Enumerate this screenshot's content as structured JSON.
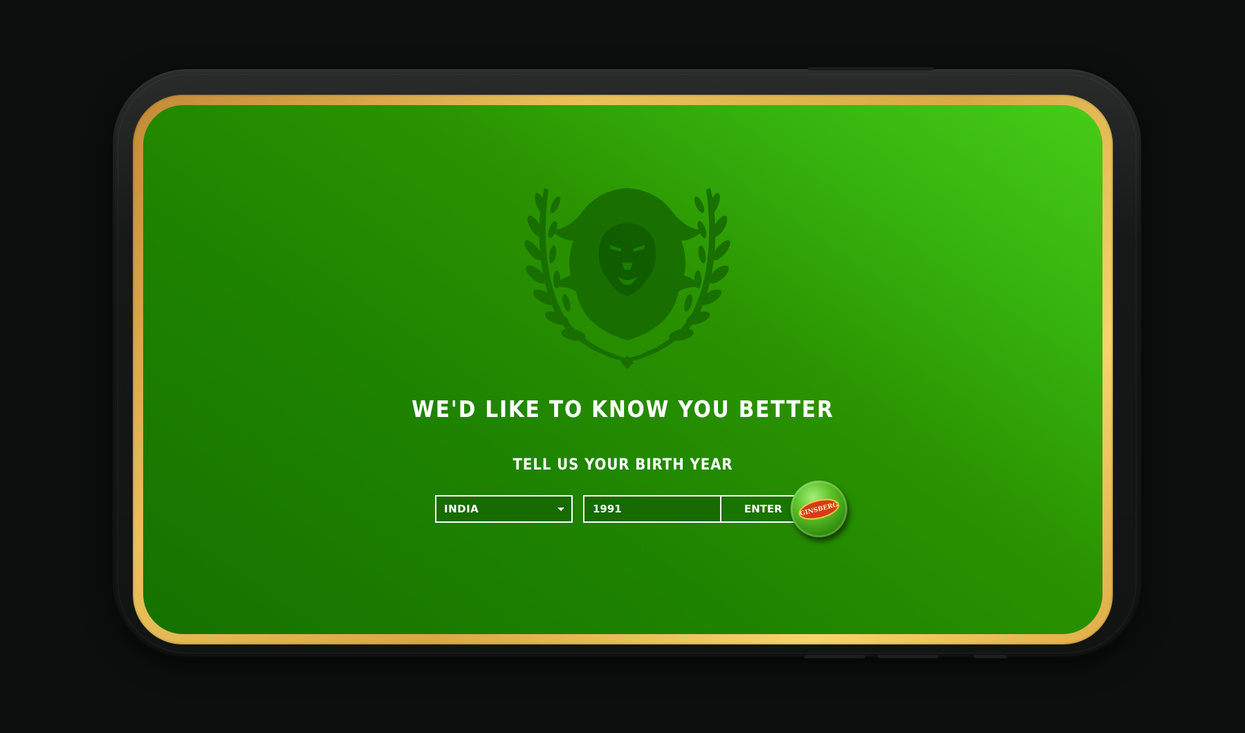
{
  "age_gate": {
    "headline": "WE'D LIKE TO KNOW YOU BETTER",
    "subheadline": "TELL US YOUR BIRTH YEAR",
    "country_select": {
      "selected": "INDIA"
    },
    "birth_year_input": {
      "value": "1991"
    },
    "enter_button": {
      "label": "ENTER"
    },
    "brand_badge": {
      "text": "GINSBERG"
    }
  },
  "colors": {
    "background": "#0d0f0f",
    "screen_green": "#1f8500",
    "field_green": "#176b00",
    "gold_bezel": "#e9c15a",
    "text": "#ffffff"
  },
  "icons": {
    "emblem": "lion-laurel-crest-icon",
    "dropdown": "caret-down-icon",
    "bottle_cap": "bottle-cap-icon"
  }
}
